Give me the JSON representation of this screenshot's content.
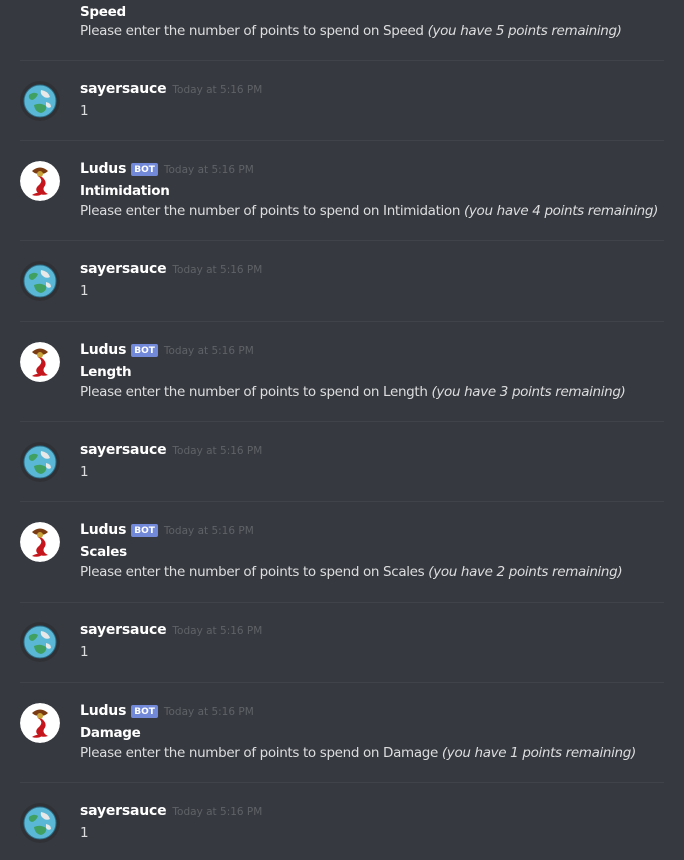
{
  "top_partial": {
    "title": "Speed",
    "prompt": "Please enter the number of points to spend on Speed",
    "remaining": "(you have 5 points remaining)"
  },
  "messages": [
    {
      "username": "sayersauce",
      "timestamp": "Today at 5:16 PM",
      "text": "1"
    },
    {
      "username": "Ludus",
      "bot_tag": "BOT",
      "timestamp": "Today at 5:16 PM",
      "title": "Intimidation",
      "prompt": "Please enter the number of points to spend on Intimidation",
      "remaining": "(you have 4 points remaining)"
    },
    {
      "username": "sayersauce",
      "timestamp": "Today at 5:16 PM",
      "text": "1"
    },
    {
      "username": "Ludus",
      "bot_tag": "BOT",
      "timestamp": "Today at 5:16 PM",
      "title": "Length",
      "prompt": "Please enter the number of points to spend on Length",
      "remaining": "(you have 3 points remaining)"
    },
    {
      "username": "sayersauce",
      "timestamp": "Today at 5:16 PM",
      "text": "1"
    },
    {
      "username": "Ludus",
      "bot_tag": "BOT",
      "timestamp": "Today at 5:16 PM",
      "title": "Scales",
      "prompt": "Please enter the number of points to spend on Scales",
      "remaining": "(you have 2 points remaining)"
    },
    {
      "username": "sayersauce",
      "timestamp": "Today at 5:16 PM",
      "text": "1"
    },
    {
      "username": "Ludus",
      "bot_tag": "BOT",
      "timestamp": "Today at 5:16 PM",
      "title": "Damage",
      "prompt": "Please enter the number of points to spend on Damage",
      "remaining": "(you have 1 points remaining)"
    },
    {
      "username": "sayersauce",
      "timestamp": "Today at 5:16 PM",
      "text": "1"
    }
  ],
  "icons": {
    "user_avatar": "globe-avatar-icon",
    "bot_avatar": "dragon-avatar-icon"
  },
  "colors": {
    "background": "#36393f",
    "bot_tag": "#7289da",
    "username": "#ffffff",
    "text": "#dcddde",
    "timestamp": "#5f6267"
  }
}
